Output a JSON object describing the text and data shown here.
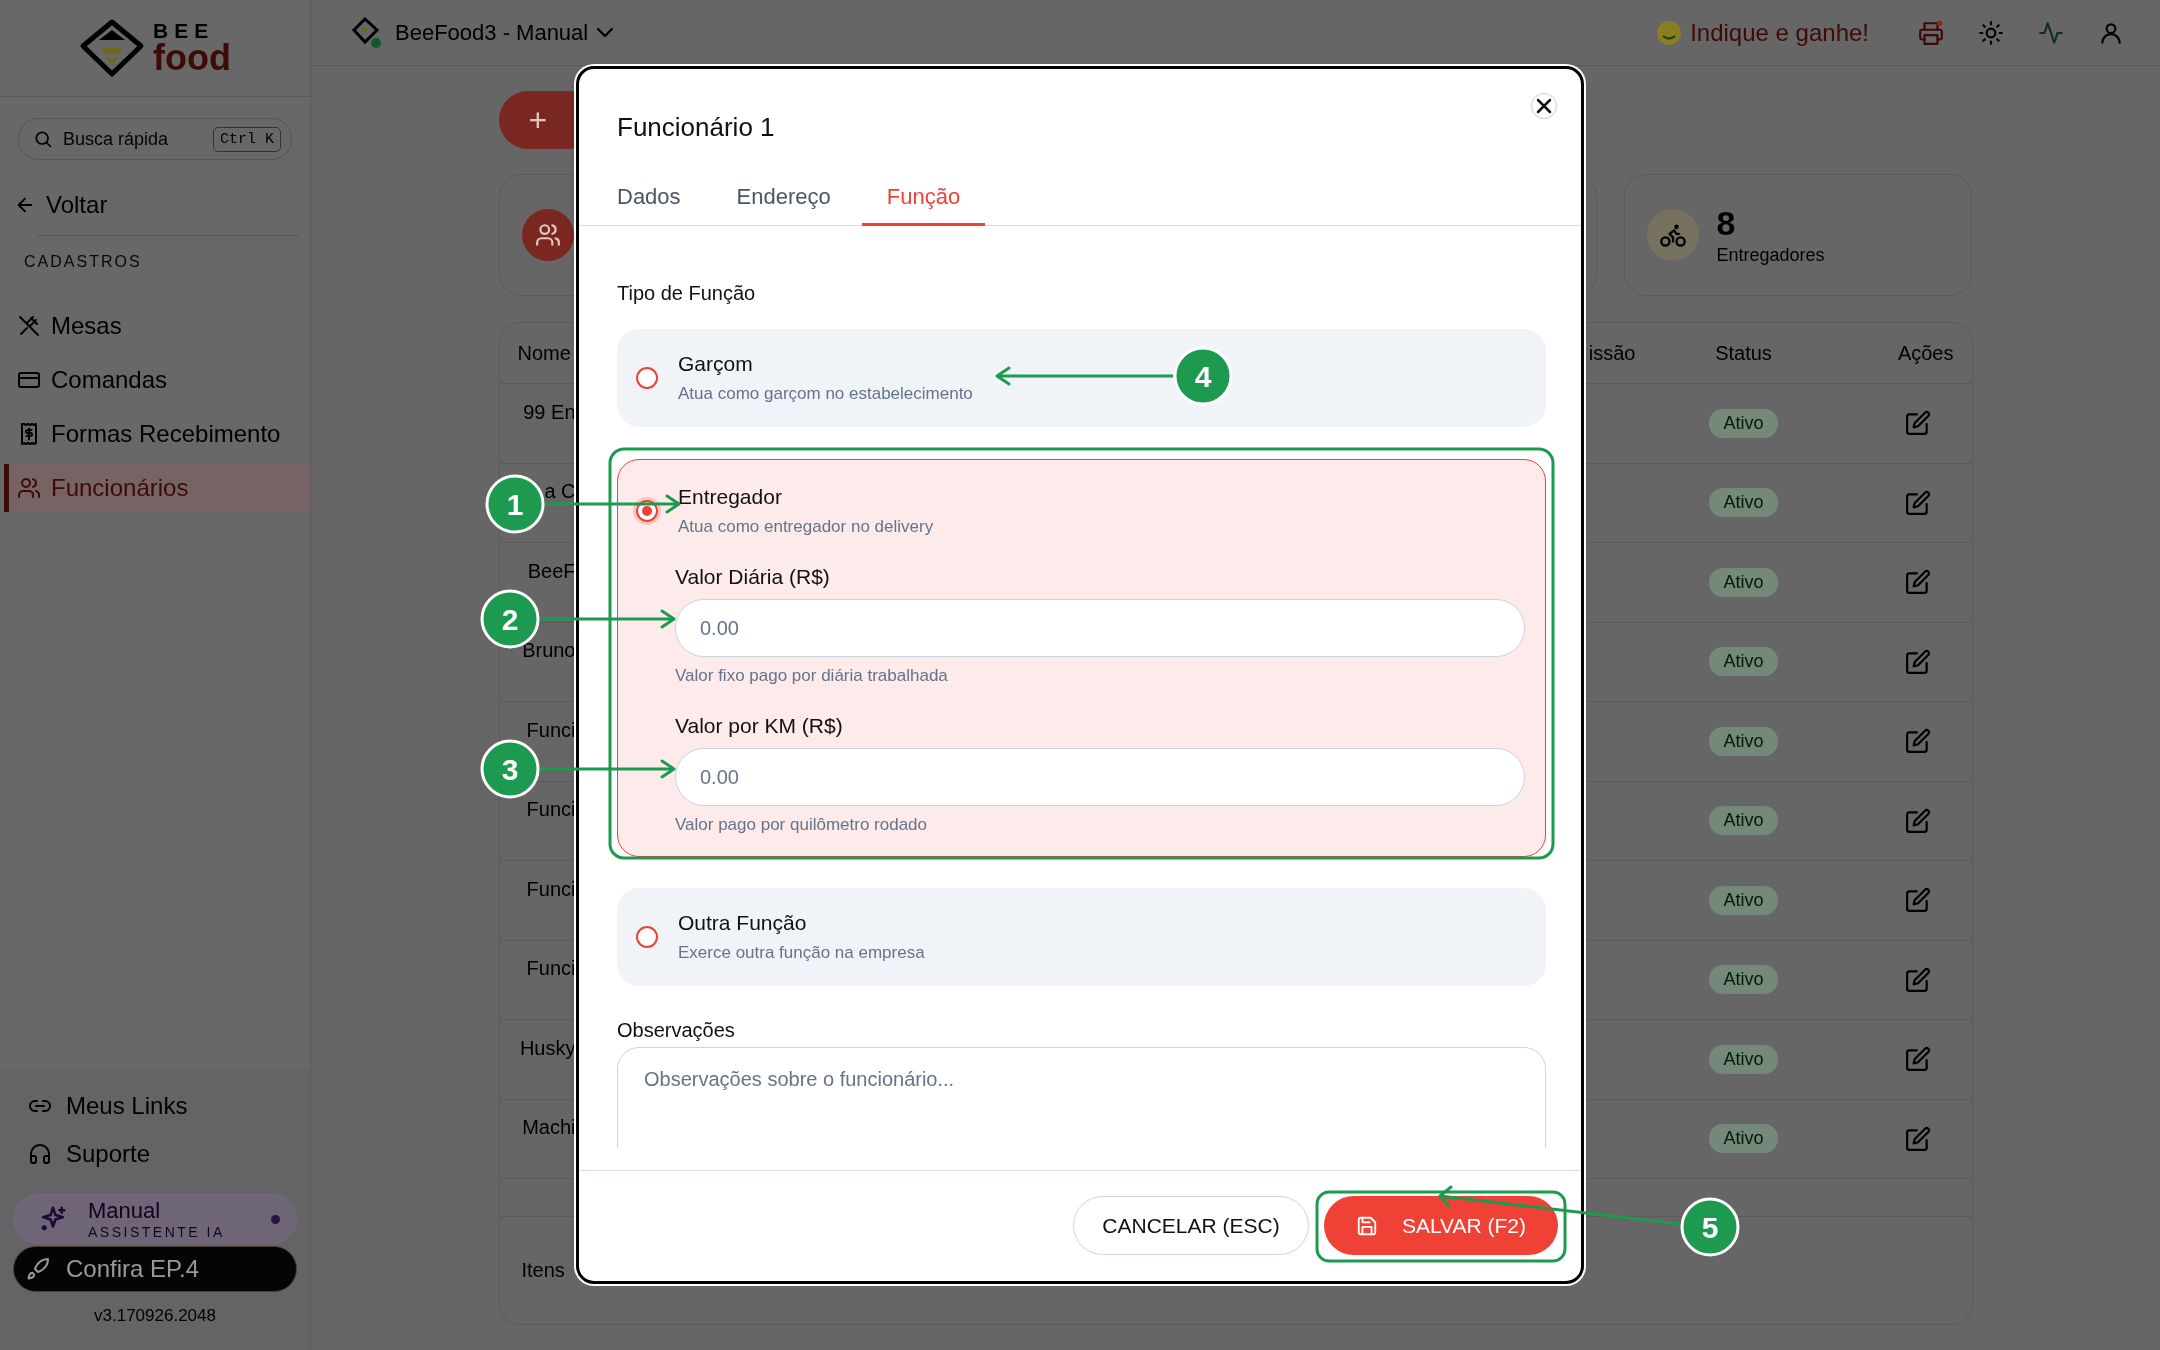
{
  "sidebar": {
    "logo_top": "BEE",
    "logo_bottom": "food",
    "search": {
      "placeholder": "Busca rápida",
      "shortcut": "Ctrl K"
    },
    "back": "Voltar",
    "section_title": "CADASTROS",
    "items": [
      {
        "label": "Mesas",
        "selected": false
      },
      {
        "label": "Comandas",
        "selected": false
      },
      {
        "label": "Formas Recebimento",
        "selected": false
      },
      {
        "label": "Funcionários",
        "selected": true
      }
    ],
    "links": [
      {
        "label": "Meus Links"
      },
      {
        "label": "Suporte"
      }
    ],
    "assistant": {
      "title": "Manual",
      "subtitle": "ASSISTENTE IA"
    },
    "promo": "Confira EP.4",
    "version": "v3.170926.2048"
  },
  "topbar": {
    "workspace": "BeeFood3 - Manual",
    "referral": "Indique e ganhe!"
  },
  "page": {
    "add_button": "+",
    "stats": [
      {
        "value": "8",
        "label": "Entregadores"
      }
    ],
    "table": {
      "columns": [
        "Nome",
        "issão",
        "Status",
        "Ações"
      ],
      "rows": [
        {
          "name": "99 En",
          "status": "Ativo"
        },
        {
          "name": "a C",
          "status": "Ativo"
        },
        {
          "name": "BeeF",
          "status": "Ativo"
        },
        {
          "name": "Bruno",
          "status": "Ativo"
        },
        {
          "name": "Funci",
          "status": "Ativo"
        },
        {
          "name": "Funci",
          "status": "Ativo"
        },
        {
          "name": "Funci",
          "status": "Ativo"
        },
        {
          "name": "Funci",
          "status": "Ativo"
        },
        {
          "name": "Husky",
          "status": "Ativo"
        },
        {
          "name": "Machi",
          "status": "Ativo"
        }
      ],
      "footer": "Itens"
    }
  },
  "modal": {
    "title": "Funcionário 1",
    "tabs": [
      {
        "label": "Dados",
        "selected": false
      },
      {
        "label": "Endereço",
        "selected": false
      },
      {
        "label": "Função",
        "selected": true
      }
    ],
    "section_title": "Tipo de Função",
    "options": [
      {
        "title": "Garçom",
        "description": "Atua como garçom no estabelecimento",
        "selected": false
      },
      {
        "title": "Entregador",
        "description": "Atua como entregador no delivery",
        "selected": true,
        "fields": [
          {
            "label": "Valor Diária (R$)",
            "placeholder": "0.00",
            "hint": "Valor fixo pago por diária trabalhada"
          },
          {
            "label": "Valor por KM (R$)",
            "placeholder": "0.00",
            "hint": "Valor pago por quilômetro rodado"
          }
        ]
      },
      {
        "title": "Outra Função",
        "description": "Exerce outra função na empresa",
        "selected": false
      }
    ],
    "notes": {
      "label": "Observações",
      "placeholder": "Observações sobre o funcionário..."
    },
    "buttons": [
      {
        "label": "CANCELAR (ESC)",
        "kind": "secondary"
      },
      {
        "label": "SALVAR (F2)",
        "kind": "primary"
      }
    ]
  },
  "callouts": [
    {
      "number": "1"
    },
    {
      "number": "2"
    },
    {
      "number": "3"
    },
    {
      "number": "4"
    },
    {
      "number": "5"
    }
  ]
}
